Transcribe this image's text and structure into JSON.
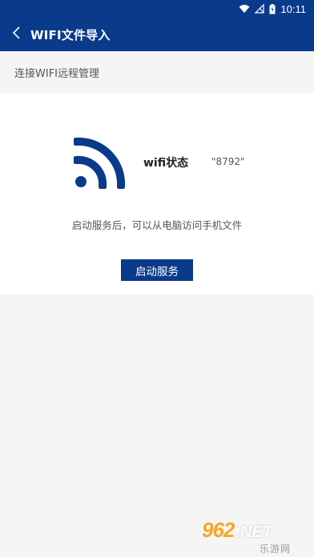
{
  "status_bar": {
    "time": "10:11",
    "icons": [
      "wifi-signal-icon",
      "cell-signal-off-icon",
      "battery-charging-icon"
    ]
  },
  "app_bar": {
    "back_icon": "chevron-left-icon",
    "title": "WIFI文件导入"
  },
  "subheader": {
    "text": "连接WIFI远程管理"
  },
  "wifi_card": {
    "icon": "wifi-icon",
    "status_label": "wifi状态",
    "status_value": "\"8792\"",
    "hint": "启动服务后，可以从电脑访问手机文件",
    "start_button_label": "启动服务"
  },
  "watermark": {
    "number": "962",
    "suffix": ".NET",
    "subtitle": "乐游网"
  },
  "colors": {
    "primary": "#0a3a8a",
    "background": "#f5f5f5",
    "card": "#ffffff"
  }
}
